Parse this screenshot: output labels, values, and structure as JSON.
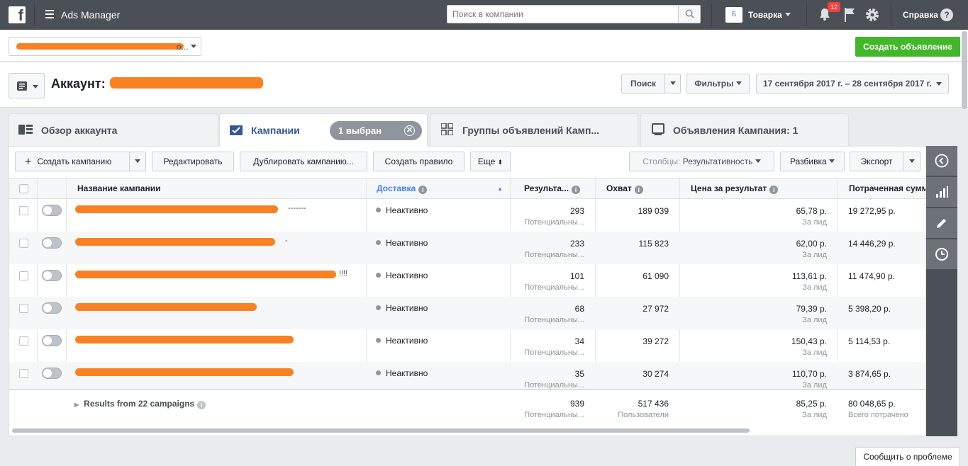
{
  "topbar": {
    "app_title": "Ads Manager",
    "search_placeholder": "Поиск в компании",
    "account_badge": "Б",
    "account_name": "Товарка",
    "notifications_count": "12",
    "help_label": "Справка"
  },
  "subbar": {
    "business_select_suffix": "o...",
    "create_ad_label": "Создать объявление"
  },
  "account": {
    "label": "Аккаунт:",
    "search_label": "Поиск",
    "filters_label": "Фильтры",
    "date_range": "17 сентября 2017 г. – 28 сентября 2017 г."
  },
  "tabs": {
    "overview": "Обзор аккаунта",
    "campaigns": "Кампании",
    "selected": "1 выбран",
    "adsets": "Группы объявлений Камп...",
    "ads": "Объявления Кампания: 1"
  },
  "toolbar": {
    "create_campaign": "Создать кампанию",
    "edit": "Редактировать",
    "duplicate": "Дублировать кампанию...",
    "create_rule": "Создать правило",
    "more": "Еще",
    "columns_prefix": "Столбцы:",
    "columns_value": "Результативность",
    "breakdown": "Разбивка",
    "export": "Экспорт"
  },
  "table": {
    "headers": {
      "name": "Название кампании",
      "delivery": "Доставка",
      "results": "Результа...",
      "reach": "Охват",
      "cost": "Цена за результат",
      "spent": "Потраченная сумм"
    },
    "rows": [
      {
        "delivery": "Неактивно",
        "results": "293",
        "results_sub": "Потенциальны...",
        "reach": "189 039",
        "cost": "65,78 р.",
        "cost_sub": "За лид",
        "spent": "19 272,95 р.",
        "name_tail": "-------"
      },
      {
        "delivery": "Неактивно",
        "results": "233",
        "results_sub": "Потенциальны...",
        "reach": "115 823",
        "cost": "62,00 р.",
        "cost_sub": "За лид",
        "spent": "14 446,29 р.",
        "name_tail": "-"
      },
      {
        "delivery": "Неактивно",
        "results": "101",
        "results_sub": "Потенциальны...",
        "reach": "61 090",
        "cost": "113,61 р.",
        "cost_sub": "За лид",
        "spent": "11 474,90 р.",
        "name_tail": "!!!!"
      },
      {
        "delivery": "Неактивно",
        "results": "68",
        "results_sub": "Потенциальны...",
        "reach": "27 972",
        "cost": "79,39 р.",
        "cost_sub": "За лид",
        "spent": "5 398,20 р.",
        "name_tail": ""
      },
      {
        "delivery": "Неактивно",
        "results": "34",
        "results_sub": "Потенциальны...",
        "reach": "39 272",
        "cost": "150,43 р.",
        "cost_sub": "За лид",
        "spent": "5 114,53 р.",
        "name_tail": ""
      },
      {
        "delivery": "Неактивно",
        "results": "35",
        "results_sub": "Потенциальны...",
        "reach": "30 274",
        "cost": "110,70 р.",
        "cost_sub": "За лид",
        "spent": "3 874,65 р.",
        "name_tail": ""
      }
    ],
    "totals": {
      "label": "Results from 22 campaigns",
      "results": "939",
      "results_sub": "Потенциальны...",
      "reach": "517 436",
      "reach_sub": "Пользователи",
      "cost": "85,25 р.",
      "cost_sub": "За лид",
      "spent": "80 048,65 р.",
      "spent_sub": "Всего потрачено"
    }
  },
  "footer": {
    "report_label": "Сообщить о проблеме"
  },
  "colors": {
    "topbar": "#4b4f56",
    "accent": "#365899",
    "green": "#42b72a",
    "redaction": "#fa8024"
  }
}
